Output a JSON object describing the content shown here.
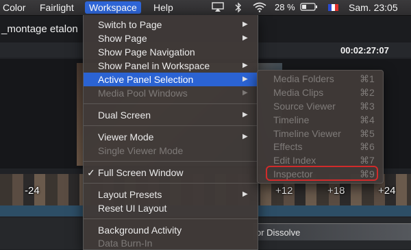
{
  "menubar": {
    "items": [
      "Color",
      "Fairlight",
      "Workspace",
      "Help"
    ],
    "battery": "28 %",
    "clock": "Sam. 23:05",
    "icons": [
      "airplay-icon",
      "bluetooth-icon",
      "wifi-icon",
      "battery-icon",
      "flag-fr-icon"
    ]
  },
  "app": {
    "project_title": "_montage etalon",
    "timecode": "00:02:27:07",
    "filmstrip_labels": [
      "-24",
      "+12",
      "+18",
      "+24"
    ],
    "transition_label": "or Dissolve"
  },
  "workspace_menu": {
    "items": [
      {
        "label": "Switch to Page",
        "arrow": "▶"
      },
      {
        "label": "Show Page",
        "arrow": "▶"
      },
      {
        "label": "Show Page Navigation"
      },
      {
        "label": "Show Panel in Workspace",
        "arrow": "▶"
      },
      {
        "label": "Active Panel Selection",
        "arrow": "▶"
      },
      {
        "label": "Media Pool Windows",
        "arrow": "▶"
      },
      {
        "label": "Dual Screen",
        "arrow": "▶"
      },
      {
        "label": "Viewer Mode",
        "arrow": "▶"
      },
      {
        "label": "Single Viewer Mode"
      },
      {
        "label": "Full Screen Window",
        "check": "✓"
      },
      {
        "label": "Layout Presets",
        "arrow": "▶"
      },
      {
        "label": "Reset UI Layout"
      },
      {
        "label": "Background Activity"
      },
      {
        "label": "Data Burn-In"
      }
    ]
  },
  "active_panel_submenu": {
    "items": [
      {
        "label": "Media Folders",
        "shortcut": "⌘1"
      },
      {
        "label": "Media Clips",
        "shortcut": "⌘2"
      },
      {
        "label": "Source Viewer",
        "shortcut": "⌘3"
      },
      {
        "label": "Timeline",
        "shortcut": "⌘4"
      },
      {
        "label": "Timeline Viewer",
        "shortcut": "⌘5"
      },
      {
        "label": "Effects",
        "shortcut": "⌘6"
      },
      {
        "label": "Edit Index",
        "shortcut": "⌘7"
      },
      {
        "label": "Inspector",
        "shortcut": "⌘9"
      }
    ]
  },
  "colors": {
    "menu_highlight": "#2b63d3",
    "annotation_ring": "#d22b2b",
    "flag": [
      "#2a4bd0",
      "#ffffff",
      "#e0302a"
    ]
  }
}
